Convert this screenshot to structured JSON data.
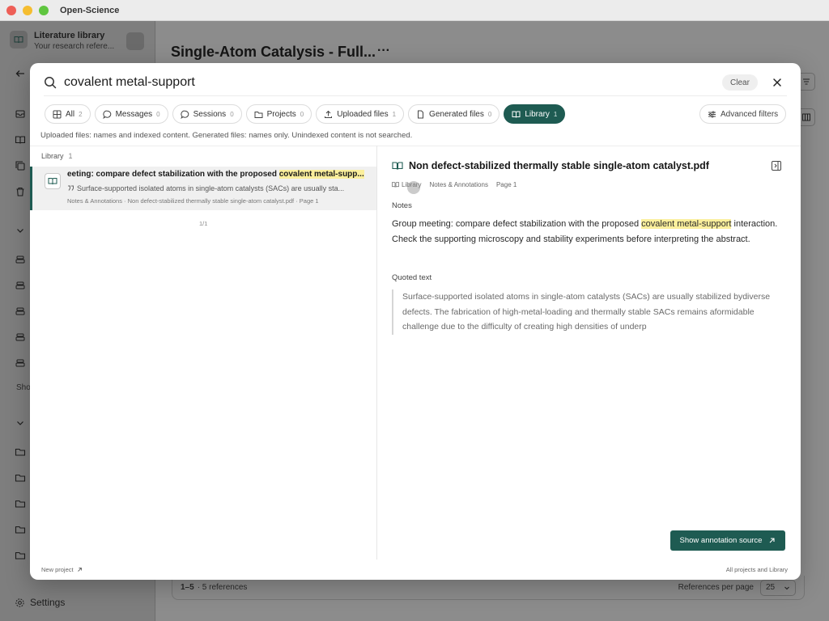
{
  "app": {
    "title": "Open-Science"
  },
  "sidebar": {
    "title": "Literature library",
    "subtitle": "Your research refere...",
    "partial_label": "Sho",
    "settings_label": "Settings"
  },
  "main": {
    "title": "Single-Atom Catalysis - Full...",
    "more_label": "···",
    "footer": {
      "range": "1–5",
      "count": "· 5 references",
      "rpp_label": "References per page",
      "rpp_value": "25"
    }
  },
  "search": {
    "query": "covalent metal-support",
    "clear_label": "Clear",
    "hint": "Uploaded files: names and indexed content. Generated files: names only. Unindexed content is not searched."
  },
  "filters": {
    "chips": [
      {
        "label": "All",
        "count": "2",
        "icon": "grid-icon"
      },
      {
        "label": "Messages",
        "count": "0",
        "icon": "chat-bubble-icon"
      },
      {
        "label": "Sessions",
        "count": "0",
        "icon": "chat-bubble-icon"
      },
      {
        "label": "Projects",
        "count": "0",
        "icon": "folder-icon"
      },
      {
        "label": "Uploaded files",
        "count": "1",
        "icon": "upload-icon"
      },
      {
        "label": "Generated files",
        "count": "0",
        "icon": "file-icon"
      },
      {
        "label": "Library",
        "count": "1",
        "icon": "book-icon"
      }
    ],
    "active": "Library",
    "advanced_label": "Advanced filters"
  },
  "results": {
    "group_label": "Library",
    "group_count": "1",
    "items": [
      {
        "title_prefix": "eeting: compare defect stabilization with the proposed ",
        "title_highlight": "covalent metal-supp...",
        "snippet": "Surface-supported isolated atoms in single-atom catalysts (SACs) are usually sta...",
        "meta": "Notes & Annotations · Non defect-stabilized thermally stable single-atom catalyst.pdf · Page 1"
      }
    ],
    "pager": "1/1"
  },
  "detail": {
    "title": "Non defect-stabilized thermally stable single-atom catalyst.pdf",
    "tags": [
      "Library",
      "Notes & Annotations",
      "Page 1"
    ],
    "notes_label": "Notes",
    "notes_prefix": "Group meeting: compare defect stabilization with the proposed ",
    "notes_highlight": "covalent metal-support",
    "notes_suffix": " interaction. Check the supporting microscopy and stability experiments before interpreting the abstract.",
    "quoted_label": "Quoted text",
    "quoted_text": "Surface-supported isolated atoms in single-atom catalysts (SACs) are usually stabilized bydiverse defects. The fabrication of high-metal-loading and thermally stable SACs remains aformidable challenge due to the difficulty of creating high densities of underp",
    "show_source_label": "Show annotation source"
  },
  "modal_footer": {
    "left": "New project",
    "right": "All projects and Library"
  },
  "colors": {
    "accent": "#1e5b52",
    "highlight": "#fbef9c"
  }
}
